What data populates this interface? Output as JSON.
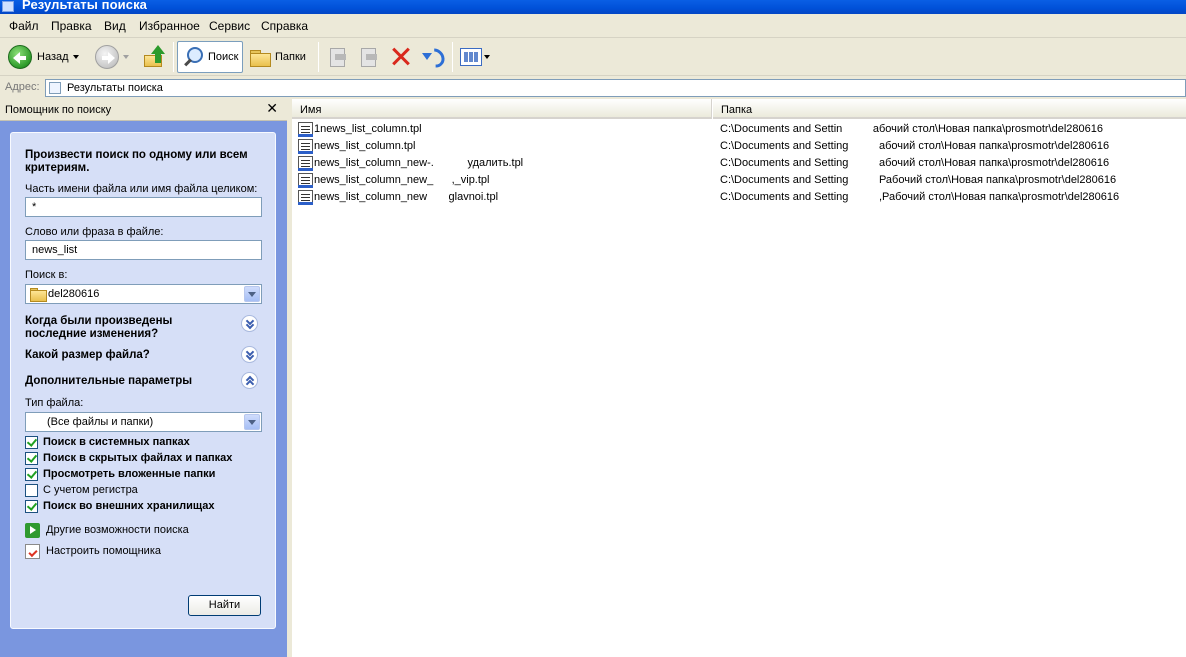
{
  "window": {
    "title": "Результаты поиска"
  },
  "menu": {
    "items": [
      "Файл",
      "Правка",
      "Вид",
      "Избранное",
      "Сервис",
      "Справка"
    ]
  },
  "toolbar": {
    "back_label": "Назад",
    "search_label": "Поиск",
    "folders_label": "Папки"
  },
  "address": {
    "label": "Адрес:",
    "value": "Результаты поиска"
  },
  "search_pane": {
    "header": "Помощник по поиску",
    "close_glyph": "✕",
    "heading": "Произвести поиск по одному или всем критериям.",
    "filename_label": "Часть имени файла или имя файла целиком:",
    "filename_value": "*",
    "phrase_label": "Слово или фраза в файле:",
    "phrase_value": "news_list",
    "lookin_label": "Поиск в:",
    "lookin_value": "del280616",
    "section_modified": "Когда были произведены последние изменения?",
    "section_size": "Какой размер файла?",
    "section_advanced": "Дополнительные параметры",
    "filetype_label": "Тип файла:",
    "filetype_value": "(Все файлы и папки)",
    "options": [
      {
        "label": "Поиск в системных папках",
        "checked": true
      },
      {
        "label": "Поиск в скрытых файлах и папках",
        "checked": true
      },
      {
        "label": "Просмотреть вложенные папки",
        "checked": true
      },
      {
        "label": "С учетом регистра",
        "checked": false
      },
      {
        "label": "Поиск во внешних хранилищах",
        "checked": true
      }
    ],
    "link_other": "Другие возможности поиска",
    "link_customize": "Настроить помощника",
    "find_button": "Найти"
  },
  "results": {
    "columns": [
      "Имя",
      "Папка"
    ],
    "rows": [
      {
        "name": "1news_list_column.tpl",
        "folder": "C:\\Documents and Settin          абочий стол\\Новая папка\\prosmotr\\del280616"
      },
      {
        "name": "news_list_column.tpl",
        "folder": "C:\\Documents and Setting          абочий стол\\Новая папка\\prosmotr\\del280616"
      },
      {
        "name": "news_list_column_new-.           удалить.tpl",
        "folder": "C:\\Documents and Setting          абочий стол\\Новая папка\\prosmotr\\del280616"
      },
      {
        "name": "news_list_column_new_      ,_vip.tpl",
        "folder": "C:\\Documents and Setting          Рабочий стол\\Новая папка\\prosmotr\\del280616"
      },
      {
        "name": "news_list_column_new       glavnoi.tpl",
        "folder": "C:\\Documents and Setting          ,Рабочий стол\\Новая папка\\prosmotr\\del280616"
      }
    ]
  }
}
